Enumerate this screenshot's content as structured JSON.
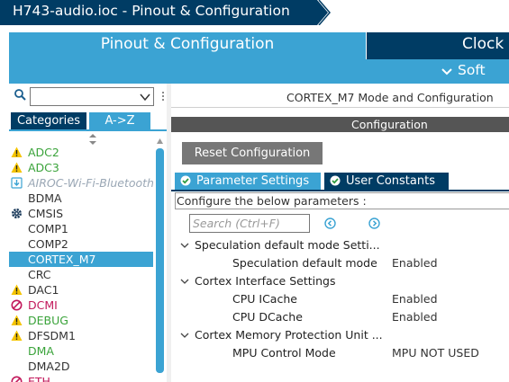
{
  "window": {
    "title": "H743-audio.ioc - Pinout & Configuration"
  },
  "tabs": {
    "pinout": "Pinout & Configuration",
    "clock": "Clock",
    "software_packs": "Soft"
  },
  "left": {
    "search_value": "",
    "tab_categories": "Categories",
    "tab_az": "A->Z",
    "items": [
      {
        "label": "ADC2",
        "icon": "warning-icon",
        "color": "#3aa33a"
      },
      {
        "label": "ADC3",
        "icon": "warning-icon",
        "color": "#3aa33a"
      },
      {
        "label": "AIROC-Wi-Fi-Bluetooth",
        "icon": "download-icon",
        "color": "#9aa7b5"
      },
      {
        "label": "BDMA",
        "icon": "",
        "color": "#333333"
      },
      {
        "label": "CMSIS",
        "icon": "gear-icon",
        "color": "#333333"
      },
      {
        "label": "COMP1",
        "icon": "",
        "color": "#333333"
      },
      {
        "label": "COMP2",
        "icon": "",
        "color": "#333333"
      },
      {
        "label": "CORTEX_M7",
        "icon": "",
        "color": "#ffffff",
        "selected": true
      },
      {
        "label": "CRC",
        "icon": "",
        "color": "#333333"
      },
      {
        "label": "DAC1",
        "icon": "warning-icon",
        "color": "#333333"
      },
      {
        "label": "DCMI",
        "icon": "forbidden-icon",
        "color": "#c2185b"
      },
      {
        "label": "DEBUG",
        "icon": "warning-icon",
        "color": "#3aa33a"
      },
      {
        "label": "DFSDM1",
        "icon": "warning-icon",
        "color": "#333333"
      },
      {
        "label": "DMA",
        "icon": "",
        "color": "#3aa33a"
      },
      {
        "label": "DMA2D",
        "icon": "",
        "color": "#333333"
      },
      {
        "label": "ETH",
        "icon": "forbidden-icon",
        "color": "#c2185b"
      }
    ]
  },
  "right": {
    "mode_title": "CORTEX_M7 Mode and Configuration",
    "config_title": "Configuration",
    "reset_button": "Reset Configuration",
    "tab_parameters": "Parameter Settings",
    "tab_user_constants": "User Constants",
    "configure_label": "Configure the below parameters :",
    "search_placeholder": "Search (Ctrl+F)",
    "groups": [
      {
        "title": "Speculation default mode Setti...",
        "params": [
          {
            "name": "Speculation default mode",
            "value": "Enabled"
          }
        ]
      },
      {
        "title": "Cortex Interface Settings",
        "params": [
          {
            "name": "CPU ICache",
            "value": "Enabled"
          },
          {
            "name": "CPU DCache",
            "value": "Enabled"
          }
        ]
      },
      {
        "title": "Cortex Memory Protection Unit ...",
        "params": [
          {
            "name": "MPU Control Mode",
            "value": "MPU NOT USED"
          }
        ]
      }
    ]
  },
  "colors": {
    "navy": "#003c64",
    "accent": "#3ba3d3",
    "green": "#3aa33a",
    "magenta": "#c2185b",
    "warning": "#f5c400"
  }
}
